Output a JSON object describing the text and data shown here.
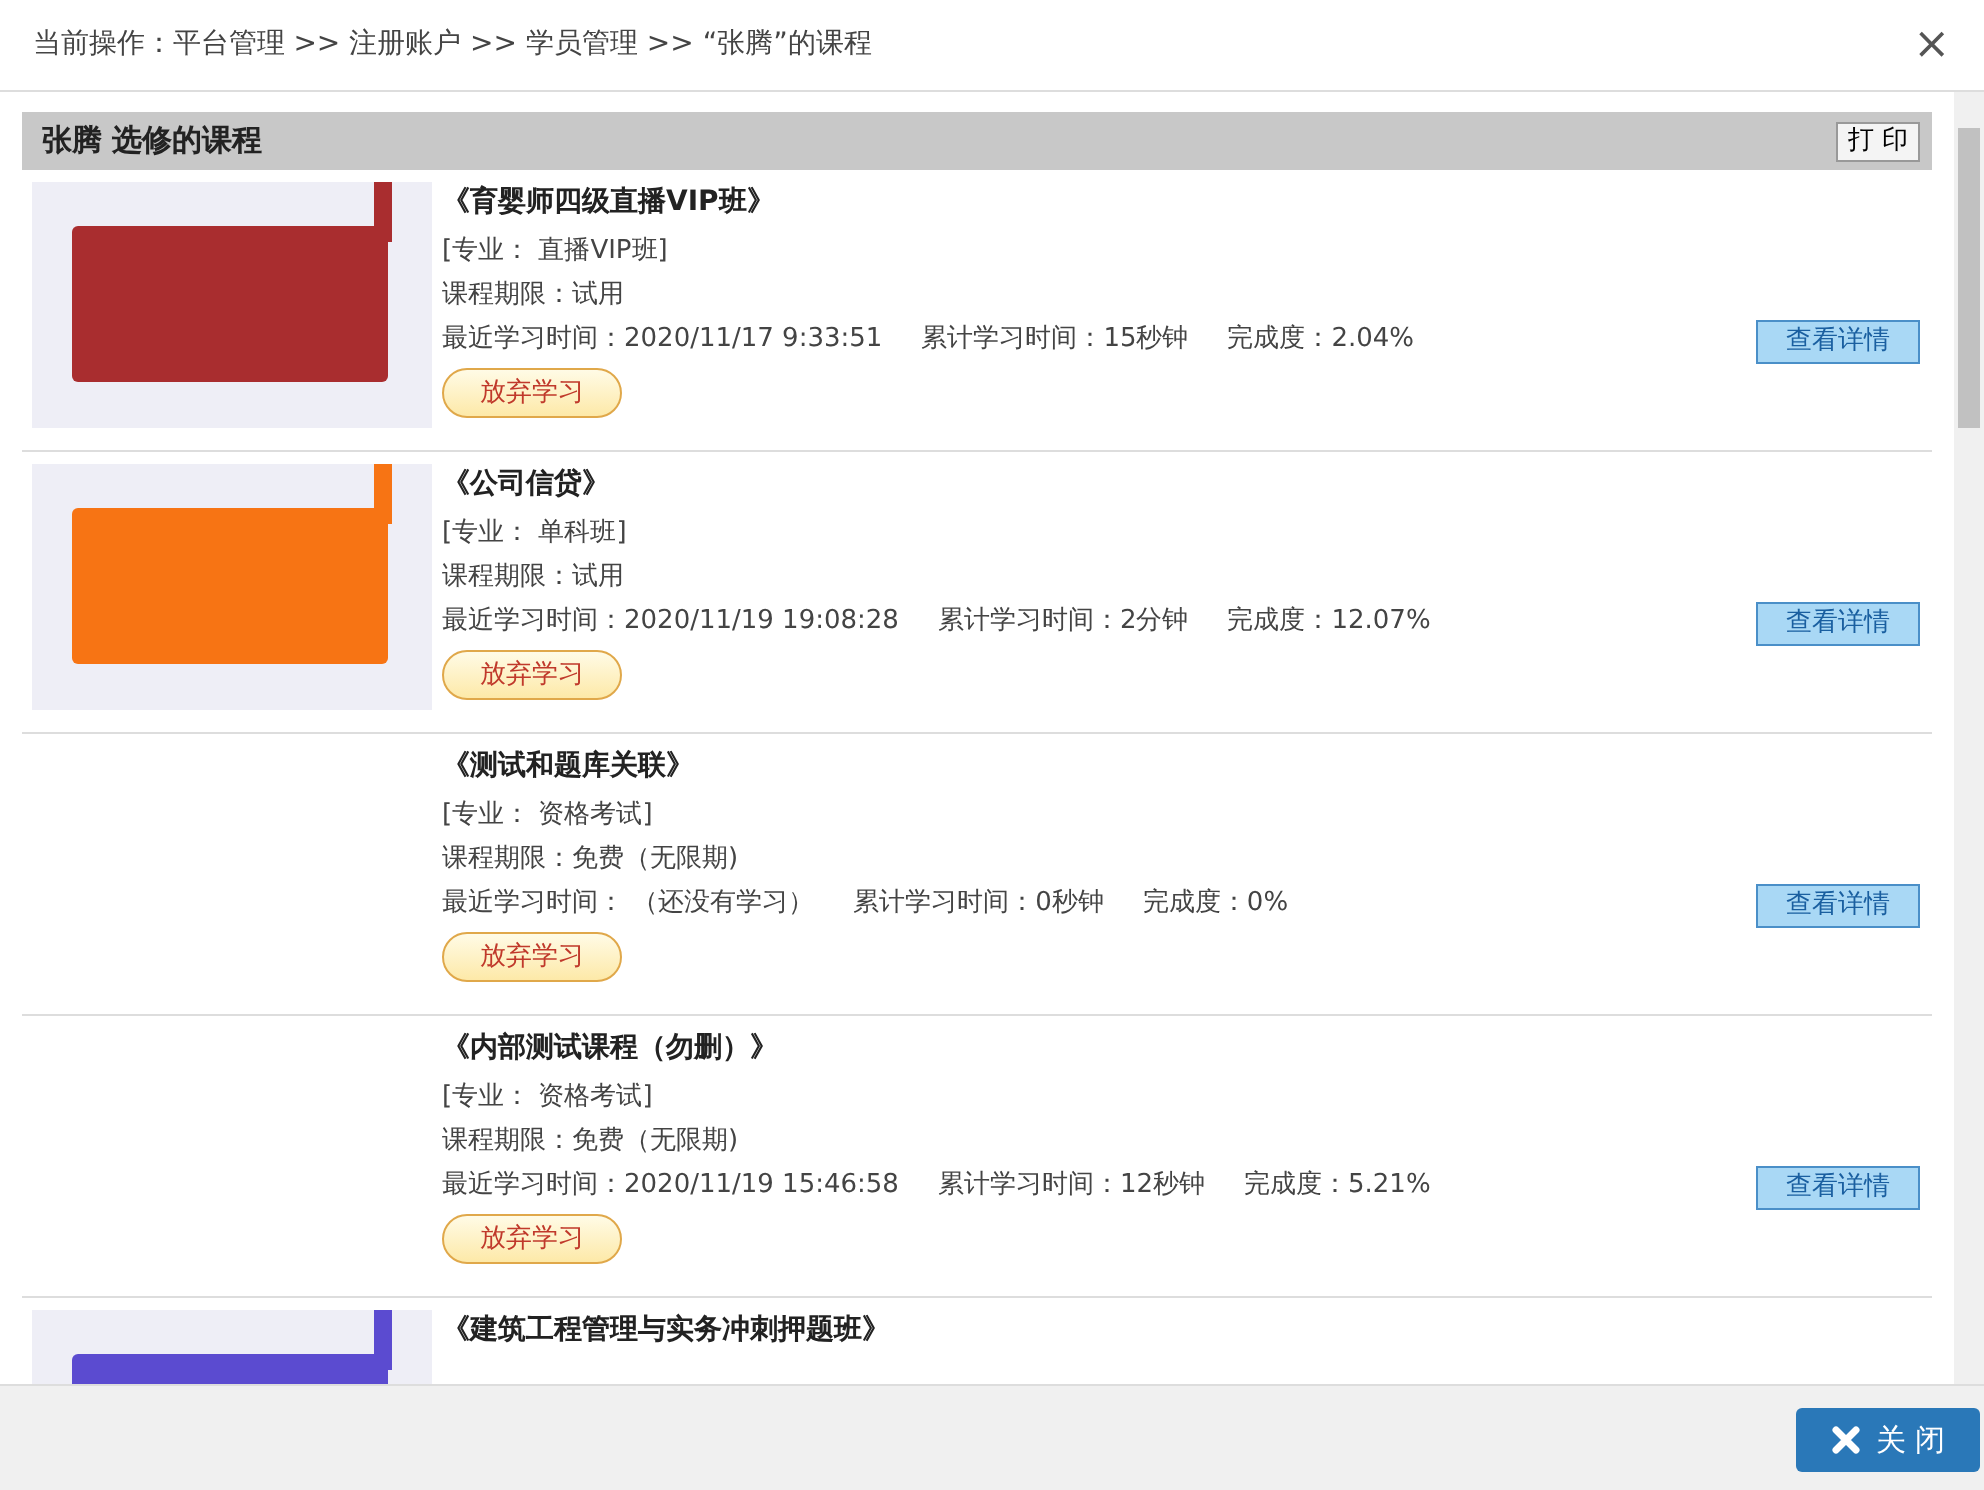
{
  "header": {
    "breadcrumb": "当前操作：平台管理 >> 注册账户 >> 学员管理 >> “张腾”的课程",
    "close": "×"
  },
  "section": {
    "title": "张腾 选修的课程",
    "print_button": "打 印"
  },
  "courses": [
    {
      "title": "《育婴师四级直播VIP班》",
      "major": "[专业： 直播VIP班]",
      "period": "课程期限：试用",
      "last_study": "最近学习时间：2020/11/17 9:33:51",
      "total_time": "累计学习时间：15秒钟",
      "completion": "完成度：2.04%",
      "abandon_button": "放弃学习",
      "detail_button": "查看详情",
      "cover": {
        "color": "#a92d2f"
      }
    },
    {
      "title": "《公司信贷》",
      "major": "[专业： 单科班]",
      "period": "课程期限：试用",
      "last_study": "最近学习时间：2020/11/19 19:08:28",
      "total_time": "累计学习时间：2分钟",
      "completion": "完成度：12.07%",
      "abandon_button": "放弃学习",
      "detail_button": "查看详情",
      "cover": {
        "color": "#f77414"
      }
    },
    {
      "title": "《测试和题库关联》",
      "major": "[专业： 资格考试]",
      "period": "课程期限：免费（无限期)",
      "last_study": "最近学习时间： （还没有学习）",
      "total_time": "累计学习时间：0秒钟",
      "completion": "完成度：0%",
      "abandon_button": "放弃学习",
      "detail_button": "查看详情"
    },
    {
      "title": "《内部测试课程（勿删）》",
      "major": "[专业： 资格考试]",
      "period": "课程期限：免费（无限期)",
      "last_study": "最近学习时间：2020/11/19 15:46:58",
      "total_time": "累计学习时间：12秒钟",
      "completion": "完成度：5.21%",
      "abandon_button": "放弃学习",
      "detail_button": "查看详情"
    },
    {
      "title": "《建筑工程管理与实务冲刺押题班》",
      "cover": {
        "color": "#5b4bd0"
      }
    }
  ],
  "footer": {
    "close_button": "关 闭"
  }
}
